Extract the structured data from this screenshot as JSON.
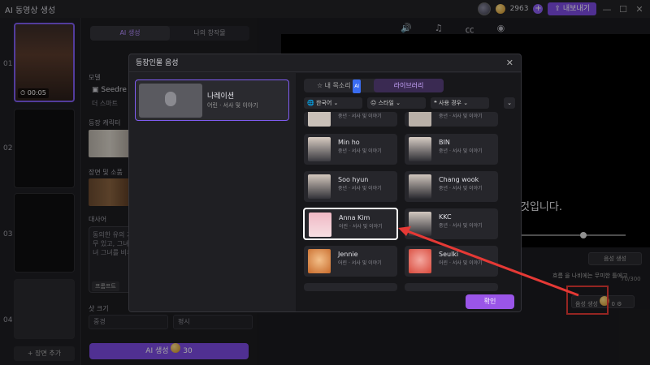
{
  "app": {
    "title": "AI 동영상 생성",
    "credits": "2963",
    "export_label": "내보내기"
  },
  "scenes": {
    "numbers": [
      "01",
      "02",
      "03",
      "04"
    ],
    "duration": "00:05",
    "add_label": "+ 장면 추가"
  },
  "settings": {
    "tabs": [
      "AI 생성",
      "나의 창작물"
    ],
    "model_label": "모델",
    "model_name": "Seedre",
    "model_sub": "더 스마트",
    "character_label": "등장 캐릭터",
    "scene_label": "장면 및 소품",
    "line_label": "대사어",
    "prompt_text": "동의한 유의 가운데, @나무 있고, 그녀의 써 있는 그녀 그녀를 비추고",
    "prompt_btn": "프롬프트",
    "size_label": "샷 크기",
    "size_fields": [
      "중경",
      "평시"
    ],
    "generate_label": "AI 생성",
    "generate_cost": "30"
  },
  "preview": {
    "subtitle": "것입니다.",
    "gen_small": "음성 생성",
    "voice_text": "흐름 을 나비에는 무미한 틀에고",
    "count": "70/300",
    "gen_small2": "음성 생성",
    "gen_small2_cost": "0"
  },
  "modal": {
    "title": "등장인물 음성",
    "narration_title": "나레이션",
    "narration_sub": "어린 · 서사 및 이야기",
    "tab_my": "내 목소리",
    "tab_ai": "AI",
    "tab_library": "라이브러리",
    "filters": [
      "한국어",
      "스타일",
      "사용 경우"
    ],
    "confirm": "확인",
    "voices": [
      {
        "name": "",
        "desc": "중년 · 서사 및 이야기"
      },
      {
        "name": "",
        "desc": "중년 · 서사 및 이야기"
      },
      {
        "name": "Min ho",
        "desc": "중년 · 서사 및 이야기"
      },
      {
        "name": "BIN",
        "desc": "중년 · 서사 및 이야기"
      },
      {
        "name": "Soo hyun",
        "desc": "중년 · 서사 및 이야기"
      },
      {
        "name": "Chang wook",
        "desc": "중년 · 서사 및 이야기"
      },
      {
        "name": "Anna Kim",
        "desc": "어린 · 서사 및 이야기"
      },
      {
        "name": "KKC",
        "desc": "중년 · 서사 및 이야기"
      },
      {
        "name": "Jennie",
        "desc": "어린 · 서사 및 이야기"
      },
      {
        "name": "Seulki",
        "desc": "어린 · 서사 및 이야기"
      }
    ]
  },
  "colors": {
    "accent": "#7b4be0",
    "highlight": "#e53935"
  }
}
